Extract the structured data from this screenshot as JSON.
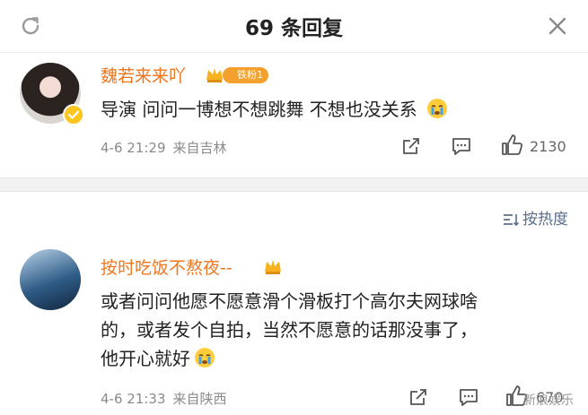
{
  "header": {
    "title": "69 条回复",
    "refresh_icon": "refresh-icon",
    "close_icon": "close-icon"
  },
  "comments": [
    {
      "username": "魏若来来吖",
      "badge_label": "铁粉1",
      "text": "导演 问问一博想不想跳舞 不想也没关系",
      "time": "4-6 21:29",
      "source": "来自吉林",
      "like_count": "2130",
      "verified": true
    },
    {
      "username": "按时吃饭不熬夜--",
      "text_lines": [
        "或者问问他愿不愿意滑个滑板打个高尔夫网球啥",
        "的，或者发个自拍，当然不愿意的话那没事了，",
        "他开心就好"
      ],
      "time": "4-6 21:33",
      "source": "来自陕西",
      "like_count": "670"
    }
  ],
  "sort": {
    "label": "按热度"
  },
  "watermark": "新浪娱乐",
  "colors": {
    "username": "#f0761d",
    "sort": "#5b6e8e",
    "divider": "#f2f2f2"
  }
}
